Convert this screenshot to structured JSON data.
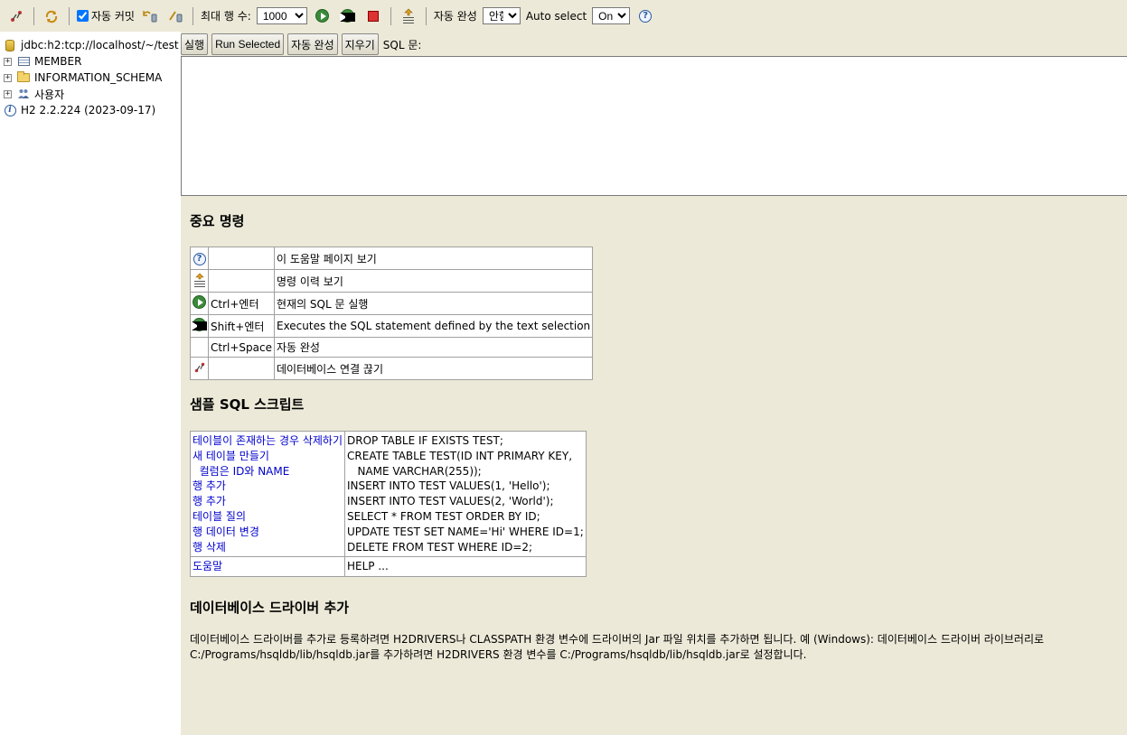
{
  "toolbar": {
    "auto_commit_label": "자동 커밋",
    "auto_commit_checked": true,
    "max_rows_label": "최대 행 수:",
    "max_rows_value": "1000",
    "autocomplete_label": "자동 완성",
    "autocomplete_value": "안함",
    "auto_select_label": "Auto select",
    "auto_select_value": "On",
    "help_glyph": "?",
    "icons": [
      "disconnect-icon",
      "refresh-icon",
      "rollback-icon",
      "commit-icon",
      "run-icon",
      "run-selected-icon",
      "stop-icon",
      "history-icon",
      "help-icon"
    ]
  },
  "sidebar": {
    "connection": "jdbc:h2:tcp://localhost/~/test",
    "items": [
      {
        "label": "MEMBER",
        "icon": "table-icon"
      },
      {
        "label": "INFORMATION_SCHEMA",
        "icon": "folder-icon"
      },
      {
        "label": "사용자",
        "icon": "users-icon"
      }
    ],
    "version": "H2 2.2.224 (2023-09-17)"
  },
  "command_bar": {
    "run": "실행",
    "run_selected": "Run Selected",
    "autocomplete": "자동 완성",
    "clear": "지우기",
    "sql_label": "SQL 문:"
  },
  "sql_text": "",
  "important": {
    "title": "중요 명령",
    "rows": [
      {
        "icon": "help-icon",
        "key": "",
        "desc": "이 도움말 페이지 보기"
      },
      {
        "icon": "history-icon",
        "key": "",
        "desc": "명령 이력 보기"
      },
      {
        "icon": "run-icon",
        "key": "Ctrl+엔터",
        "desc": "현재의 SQL 문 실행"
      },
      {
        "icon": "run-selected-icon",
        "key": "Shift+엔터",
        "desc": "Executes the SQL statement defined by the text selection"
      },
      {
        "icon": "",
        "key": "Ctrl+Space",
        "desc": "자동 완성"
      },
      {
        "icon": "disconnect-icon",
        "key": "",
        "desc": "데이터베이스 연결 끊기"
      }
    ]
  },
  "sample": {
    "title": "샘플 SQL 스크립트",
    "lines": [
      {
        "label": "테이블이 존재하는 경우 삭제하기",
        "sql": "DROP TABLE IF EXISTS TEST;"
      },
      {
        "label": "새 테이블 만들기",
        "sql": "CREATE TABLE TEST(ID INT PRIMARY KEY,"
      },
      {
        "label": "  컬럼은 ID와 NAME",
        "sql": "   NAME VARCHAR(255));"
      },
      {
        "label": "행 추가",
        "sql": "INSERT INTO TEST VALUES(1, 'Hello');"
      },
      {
        "label": "행 추가",
        "sql": "INSERT INTO TEST VALUES(2, 'World');"
      },
      {
        "label": "테이블 질의",
        "sql": "SELECT * FROM TEST ORDER BY ID;"
      },
      {
        "label": "행 데이터 변경",
        "sql": "UPDATE TEST SET NAME='Hi' WHERE ID=1;"
      },
      {
        "label": "행 삭제",
        "sql": "DELETE FROM TEST WHERE ID=2;"
      }
    ],
    "help_label": "도움말",
    "help_sql": "HELP ..."
  },
  "driver": {
    "title": "데이터베이스 드라이버 추가",
    "text": "데이터베이스 드라이버를 추가로 등록하려면 H2DRIVERS나 CLASSPATH 환경 변수에 드라이버의 Jar 파일 위치를 추가하면 됩니다. 예 (Windows): 데이터베이스 드라이버 라이브러리로 C:/Programs/hsqldb/lib/hsqldb.jar를 추가하려면 H2DRIVERS 환경 변수를 C:/Programs/hsqldb/lib/hsqldb.jar로 설정합니다."
  }
}
